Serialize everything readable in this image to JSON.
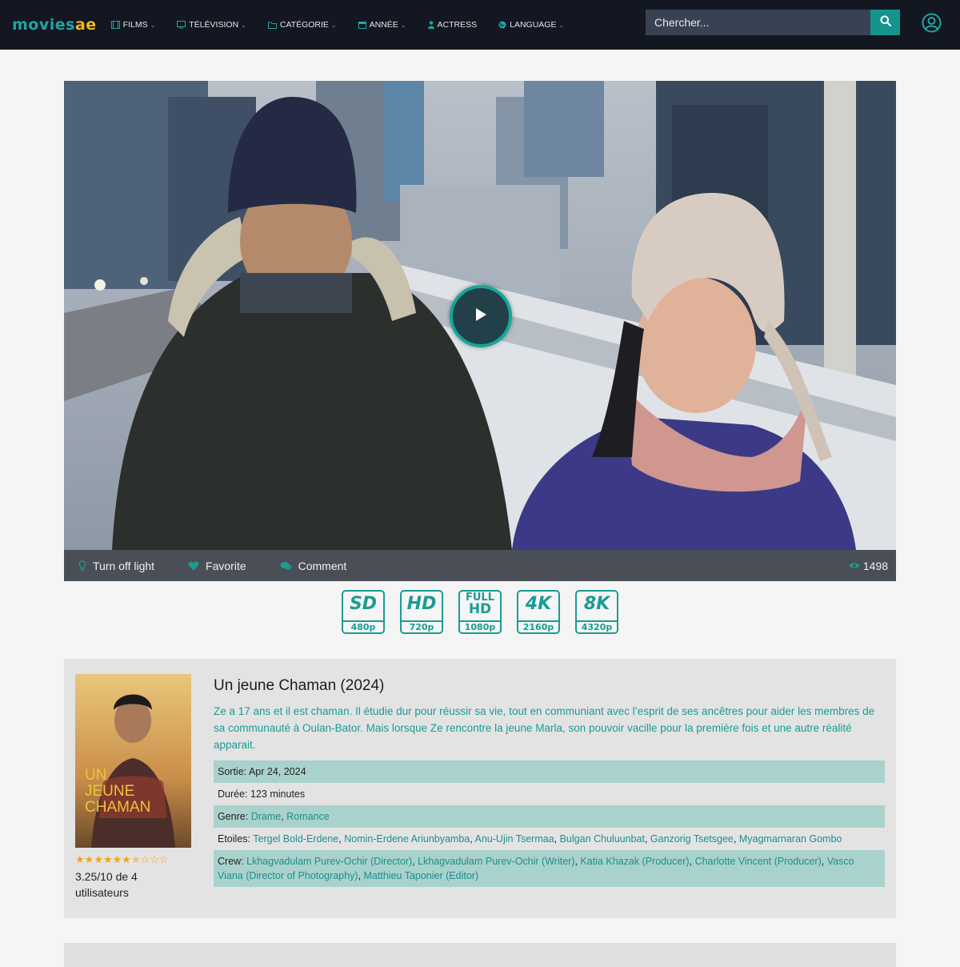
{
  "header": {
    "logo_main": "movies",
    "logo_accent": "ae",
    "nav": [
      {
        "label": "FILMS",
        "icon": "film-icon",
        "has_dropdown": true
      },
      {
        "label": "TÉLÉVISION",
        "icon": "tv-icon",
        "has_dropdown": true
      },
      {
        "label": "CATÉGORIE",
        "icon": "folder-icon",
        "has_dropdown": true
      },
      {
        "label": "ANNÉE",
        "icon": "calendar-icon",
        "has_dropdown": true
      },
      {
        "label": "ACTRESS",
        "icon": "person-icon",
        "has_dropdown": false
      },
      {
        "label": "LANGUAGE",
        "icon": "globe-icon",
        "has_dropdown": true
      }
    ],
    "search_placeholder": "Chercher...",
    "search_icon": "search-icon",
    "user_icon": "user-circle-icon"
  },
  "player": {
    "play_icon": "play-icon",
    "controls": {
      "light_label": "Turn off light",
      "favorite_label": "Favorite",
      "comment_label": "Comment",
      "views": "1498"
    }
  },
  "qualities": [
    {
      "top": "SD",
      "bottom": "480p"
    },
    {
      "top": "HD",
      "bottom": "720p"
    },
    {
      "top": "FULL HD",
      "bottom": "1080p"
    },
    {
      "top": "4K",
      "bottom": "2160p"
    },
    {
      "top": "8K",
      "bottom": "4320p"
    }
  ],
  "movie": {
    "title": "Un jeune Chaman (2024)",
    "description": "Ze a 17 ans et il est chaman. Il étudie dur pour réussir sa vie, tout en communiant avec l’esprit de ses ancêtres pour aider les membres de sa communauté à Oulan-Bator. Mais lorsque Ze rencontre la jeune Marla, son pouvoir vacille pour la première fois et une autre réalité apparait.",
    "poster_text": [
      "UN",
      "JEUNE",
      "CHAMAN"
    ],
    "rating_stars_filled": 6.5,
    "rating_stars_total": 10,
    "rating_text": "3.25/10 de 4 utilisateurs",
    "release_label": "Sortie:",
    "release_value": "Apr 24, 2024",
    "duration_label": "Durée:",
    "duration_value": "123 minutes",
    "genre_label": "Genre:",
    "genres": [
      "Drame",
      "Romance"
    ],
    "stars_label": "Etoiles:",
    "cast": [
      "Tergel Bold-Erdene",
      "Nomin-Erdene Ariunbyamba",
      "Anu-Ujin Tsermaa",
      "Bulgan Chuluunbat",
      "Ganzorig Tsetsgee",
      "Myagmarnaran Gombo"
    ],
    "crew_label": "Crew:",
    "crew": [
      "Lkhagvadulam Purev-Ochir (Director)",
      "Lkhagvadulam Purev-Ochir (Writer)",
      "Katia Khazak (Producer)",
      "Charlotte Vincent (Producer)",
      "Vasco Viana (Director of Photography)",
      "Matthieu Taponier (Editor)"
    ]
  },
  "colors": {
    "accent": "#1a9c93",
    "header_bg": "#131722",
    "star": "#f1a517"
  }
}
